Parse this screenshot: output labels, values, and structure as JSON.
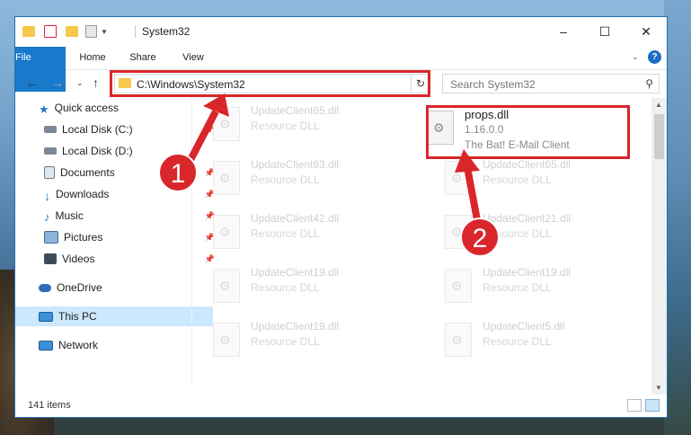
{
  "window": {
    "title": "System32"
  },
  "ribbon": {
    "tabs": [
      "File",
      "Home",
      "Share",
      "View"
    ],
    "help": "?"
  },
  "address": {
    "path": "C:\\Windows\\System32"
  },
  "search": {
    "placeholder": "Search System32"
  },
  "nav": {
    "items": [
      {
        "label": "Quick access",
        "icon": "star-icon",
        "pinned": false
      },
      {
        "label": "Local Disk (C:)",
        "icon": "drive-icon",
        "pinned": true
      },
      {
        "label": "Local Disk (D:)",
        "icon": "drive-icon",
        "pinned": false
      },
      {
        "label": "Documents",
        "icon": "documents-icon",
        "pinned": true
      },
      {
        "label": "Downloads",
        "icon": "download-icon",
        "pinned": true
      },
      {
        "label": "Music",
        "icon": "music-icon",
        "pinned": true
      },
      {
        "label": "Pictures",
        "icon": "pictures-icon",
        "pinned": true
      },
      {
        "label": "Videos",
        "icon": "videos-icon",
        "pinned": true
      },
      {
        "label": "OneDrive",
        "icon": "cloud-icon",
        "pinned": false
      },
      {
        "label": "This PC",
        "icon": "computer-icon",
        "pinned": false,
        "selected": true
      },
      {
        "label": "Network",
        "icon": "network-icon",
        "pinned": false
      }
    ]
  },
  "files": {
    "left_column": [
      {
        "name": "UpdateClient65.dll",
        "type": "Resource DLL"
      },
      {
        "name": "UpdateClient63.dll",
        "type": "Resource DLL"
      },
      {
        "name": "UpdateClient42.dll",
        "type": "Resource DLL"
      },
      {
        "name": "UpdateClient19.dll",
        "type": "Resource DLL"
      },
      {
        "name": "UpdateClient19.dll",
        "type": "Resource DLL"
      }
    ],
    "right_column": [
      {
        "name": "props.dll",
        "version": "1.16.0.0",
        "description": "The Bat! E-Mail Client"
      },
      {
        "name": "UpdateClient65.dll",
        "type": "Resource DLL"
      },
      {
        "name": "UpdateClient21.dll",
        "type": "Resource DLL"
      },
      {
        "name": "UpdateClient19.dll",
        "type": "Resource DLL"
      },
      {
        "name": "UpdateClient5.dll",
        "type": "Resource DLL"
      }
    ]
  },
  "status": {
    "count": "141 items"
  },
  "callouts": {
    "one": "1",
    "two": "2"
  },
  "colors": {
    "accent": "#1979ca",
    "highlight": "#d9262a",
    "selected": "#cce8ff"
  }
}
